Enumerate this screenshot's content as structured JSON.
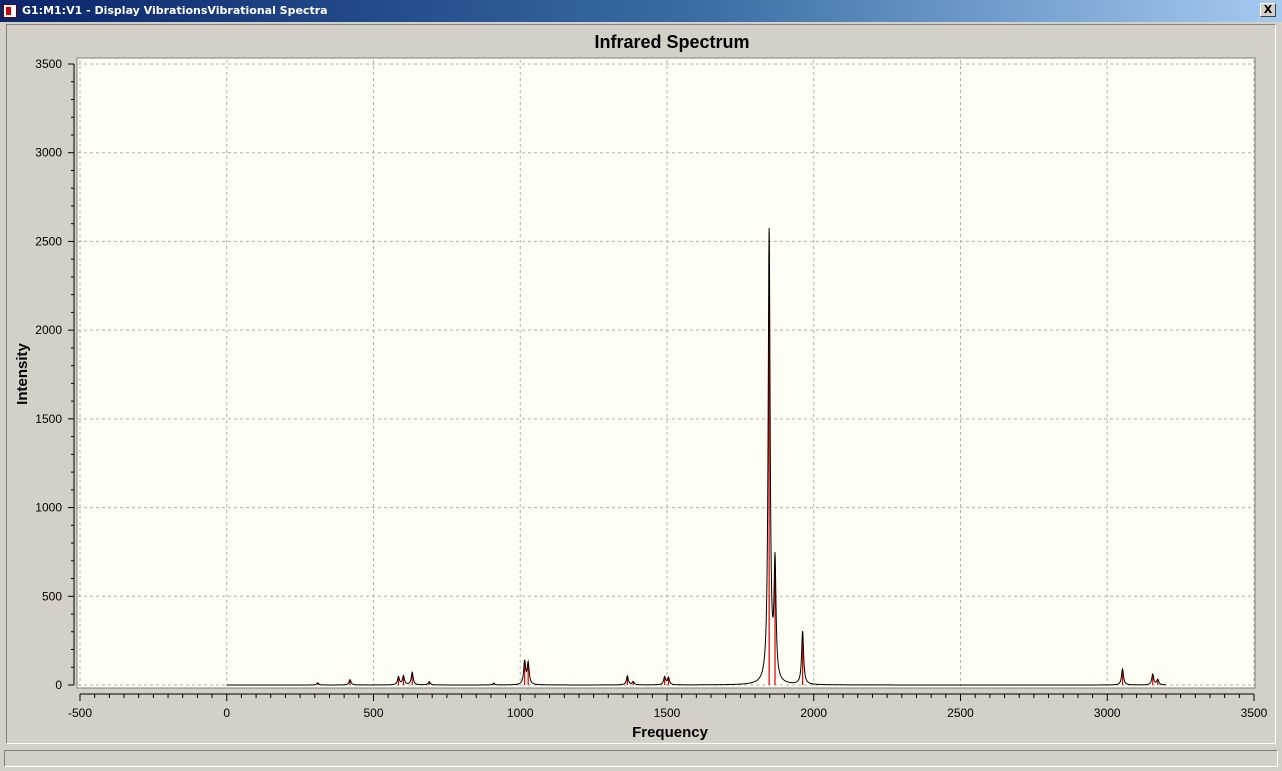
{
  "window": {
    "title": "G1:M1:V1 - Display VibrationsVibrational Spectra",
    "close_label": "X"
  },
  "chart_data": {
    "type": "line",
    "title": "Infrared Spectrum",
    "xlabel": "Frequency",
    "ylabel": "Intensity",
    "xlim": [
      -500,
      3500
    ],
    "ylim": [
      0,
      3500
    ],
    "xticks": [
      -500,
      0,
      500,
      1000,
      1500,
      2000,
      2500,
      3000,
      3500
    ],
    "yticks": [
      0,
      500,
      1000,
      1500,
      2000,
      2500,
      3000,
      3500
    ],
    "grid": true,
    "colors": {
      "spectrum": "#000000",
      "sticks": "#e00000",
      "plot_bg": "#fefef4",
      "grid": "#b0b0b0"
    },
    "x_range": [
      0,
      3200
    ],
    "peaks": [
      {
        "freq": 310,
        "intensity": 12
      },
      {
        "freq": 420,
        "intensity": 30
      },
      {
        "freq": 585,
        "intensity": 45
      },
      {
        "freq": 602,
        "intensity": 50
      },
      {
        "freq": 632,
        "intensity": 70
      },
      {
        "freq": 690,
        "intensity": 18
      },
      {
        "freq": 910,
        "intensity": 10
      },
      {
        "freq": 1015,
        "intensity": 130
      },
      {
        "freq": 1027,
        "intensity": 120
      },
      {
        "freq": 1365,
        "intensity": 50
      },
      {
        "freq": 1385,
        "intensity": 18
      },
      {
        "freq": 1492,
        "intensity": 45
      },
      {
        "freq": 1505,
        "intensity": 40
      },
      {
        "freq": 1848,
        "intensity": 2550
      },
      {
        "freq": 1868,
        "intensity": 650
      },
      {
        "freq": 1962,
        "intensity": 300
      },
      {
        "freq": 3052,
        "intensity": 90
      },
      {
        "freq": 3155,
        "intensity": 60
      },
      {
        "freq": 3172,
        "intensity": 30
      }
    ]
  }
}
